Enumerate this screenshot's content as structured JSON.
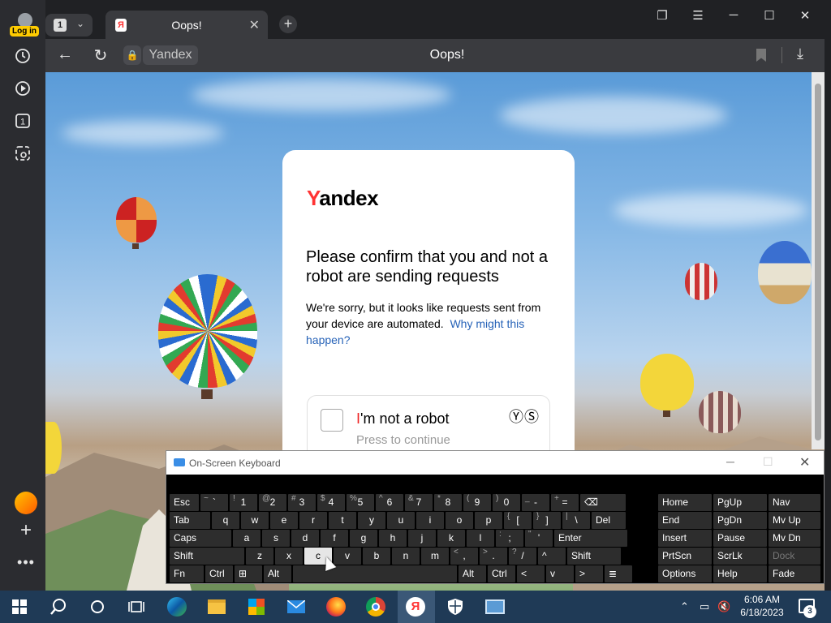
{
  "sidebar": {
    "login_label": "Log in",
    "icons": [
      "history-icon",
      "media-icon",
      "tabs-count-icon",
      "screenshot-icon"
    ],
    "tab_count": "1"
  },
  "tabstrip": {
    "tab_count": "1",
    "active_tab": {
      "title": "Oops!",
      "favicon_letter": "Я"
    }
  },
  "addressbar": {
    "site_label": "Yandex",
    "page_title": "Oops!"
  },
  "page": {
    "logo": {
      "first": "Y",
      "rest": "andex"
    },
    "heading": "Please confirm that you and not a robot are sending requests",
    "body_text": "We're sorry, but it looks like requests sent from your device are automated.",
    "link_text": "Why might this happen?",
    "captcha": {
      "label_highlight": "I",
      "label_rest": "'m not a robot",
      "sublabel": "Press to continue",
      "logo": "ⓎⓈ"
    }
  },
  "osk": {
    "title": "On-Screen Keyboard",
    "rows": [
      [
        [
          "Esc",
          ""
        ],
        [
          "`",
          "~"
        ],
        [
          "1",
          "!"
        ],
        [
          "2",
          "@"
        ],
        [
          "3",
          "#"
        ],
        [
          "4",
          "$"
        ],
        [
          "5",
          "%"
        ],
        [
          "6",
          "^"
        ],
        [
          "7",
          "&"
        ],
        [
          "8",
          "*"
        ],
        [
          "9",
          "("
        ],
        [
          "0",
          ")"
        ],
        [
          "-",
          "_"
        ],
        [
          "=",
          "+"
        ],
        [
          "⌫",
          ""
        ]
      ],
      [
        [
          "Tab",
          ""
        ],
        [
          "q",
          ""
        ],
        [
          "w",
          ""
        ],
        [
          "e",
          ""
        ],
        [
          "r",
          ""
        ],
        [
          "t",
          ""
        ],
        [
          "y",
          ""
        ],
        [
          "u",
          ""
        ],
        [
          "i",
          ""
        ],
        [
          "o",
          ""
        ],
        [
          "p",
          ""
        ],
        [
          "[",
          "{"
        ],
        [
          "]",
          "}"
        ],
        [
          "\\",
          "|"
        ],
        [
          "Del",
          ""
        ]
      ],
      [
        [
          "Caps",
          ""
        ],
        [
          "a",
          ""
        ],
        [
          "s",
          ""
        ],
        [
          "d",
          ""
        ],
        [
          "f",
          ""
        ],
        [
          "g",
          ""
        ],
        [
          "h",
          ""
        ],
        [
          "j",
          ""
        ],
        [
          "k",
          ""
        ],
        [
          "l",
          ""
        ],
        [
          ";",
          ":"
        ],
        [
          "'",
          "\""
        ],
        [
          "Enter",
          ""
        ]
      ],
      [
        [
          "Shift",
          ""
        ],
        [
          "z",
          ""
        ],
        [
          "x",
          ""
        ],
        [
          "c",
          ""
        ],
        [
          "v",
          ""
        ],
        [
          "b",
          ""
        ],
        [
          "n",
          ""
        ],
        [
          "m",
          ""
        ],
        [
          ",",
          "<"
        ],
        [
          ".",
          ">"
        ],
        [
          "/",
          "?"
        ],
        [
          "^",
          ""
        ],
        [
          "Shift",
          ""
        ]
      ],
      [
        [
          "Fn",
          ""
        ],
        [
          "Ctrl",
          ""
        ],
        [
          "⊞",
          ""
        ],
        [
          "Alt",
          ""
        ],
        [
          "",
          ""
        ],
        [
          "Alt",
          ""
        ],
        [
          "Ctrl",
          ""
        ],
        [
          "<",
          ""
        ],
        [
          "v",
          ""
        ],
        [
          ">",
          ""
        ],
        [
          "≣",
          ""
        ]
      ]
    ],
    "nav_keys": [
      [
        "Home",
        "PgUp",
        "Nav"
      ],
      [
        "End",
        "PgDn",
        "Mv Up"
      ],
      [
        "Insert",
        "Pause",
        "Mv Dn"
      ],
      [
        "PrtScn",
        "ScrLk",
        "Dock"
      ],
      [
        "Options",
        "Help",
        "Fade"
      ]
    ],
    "highlighted_key": "c"
  },
  "taskbar": {
    "time": "6:06 AM",
    "date": "6/18/2023",
    "notification_count": "3",
    "apps": [
      "start-icon",
      "search-icon",
      "cortana-icon",
      "task-view-icon",
      "edge-icon",
      "file-explorer-icon",
      "store-icon",
      "mail-icon",
      "firefox-icon",
      "chrome-icon",
      "yandex-browser-icon",
      "security-icon",
      "remote-desktop-icon"
    ]
  },
  "colors": {
    "yandex_red": "#ff3333",
    "link_blue": "#2763b8",
    "taskbar": "#1f3a56"
  }
}
